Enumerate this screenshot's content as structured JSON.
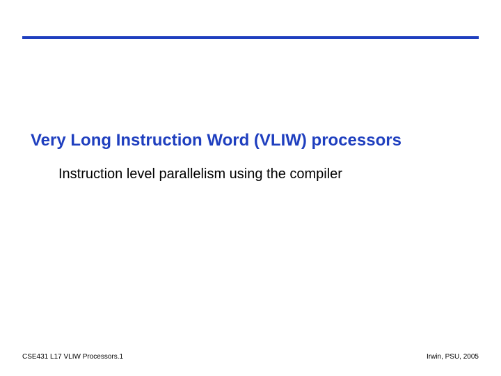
{
  "title": "Very Long Instruction Word (VLIW) processors",
  "subtitle": "Instruction level parallelism using the compiler",
  "footer": {
    "left": "CSE431 L17 VLIW Processors.1",
    "right": "Irwin, PSU, 2005"
  },
  "colors": {
    "accent": "#1f3fbf"
  }
}
